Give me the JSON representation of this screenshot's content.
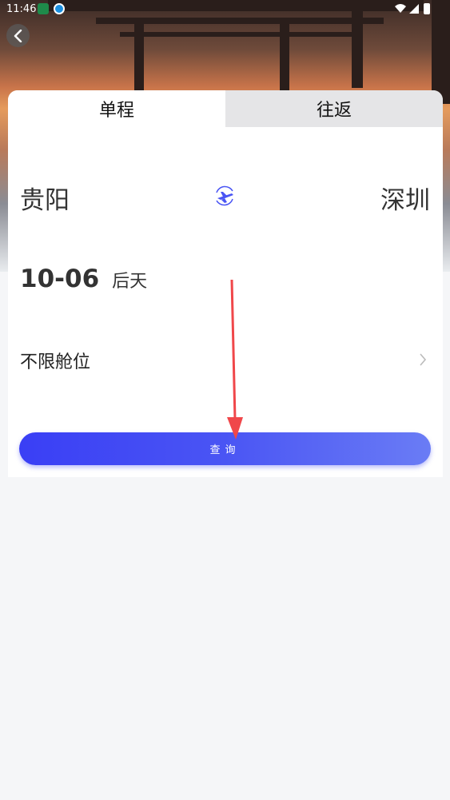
{
  "status_bar": {
    "time": "11:46"
  },
  "tabs": [
    {
      "label": "单程",
      "active": true
    },
    {
      "label": "往返",
      "active": false
    }
  ],
  "route": {
    "from": "贵阳",
    "to": "深圳"
  },
  "date": {
    "value": "10-06",
    "relative": "后天"
  },
  "cabin": {
    "label": "不限舱位"
  },
  "search_button": {
    "label": "查询"
  },
  "colors": {
    "accent": "#4a55f4",
    "arrow": "#f0474a",
    "background": "#f5f6f8"
  },
  "icons": [
    "back-arrow-icon",
    "plane-swap-icon",
    "chevron-right-icon",
    "wifi-icon",
    "battery-icon"
  ]
}
